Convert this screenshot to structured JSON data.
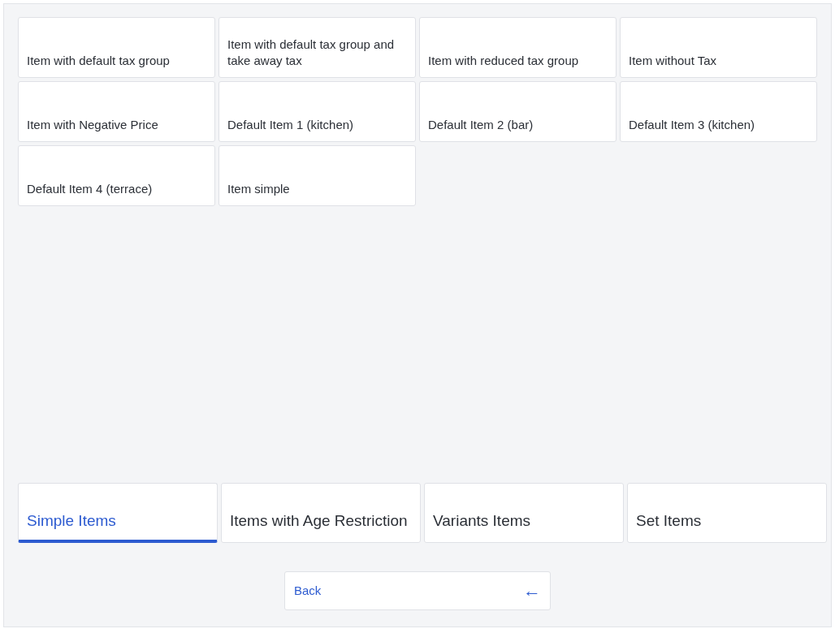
{
  "items": [
    {
      "label": "Item with default tax group"
    },
    {
      "label": "Item with default tax group and take away tax"
    },
    {
      "label": "Item with reduced tax group"
    },
    {
      "label": "Item without Tax"
    },
    {
      "label": "Item with Negative Price"
    },
    {
      "label": "Default Item 1 (kitchen)"
    },
    {
      "label": "Default Item 2 (bar)"
    },
    {
      "label": "Default Item 3 (kitchen)"
    },
    {
      "label": "Default Item 4 (terrace)"
    },
    {
      "label": "Item simple"
    }
  ],
  "tabs": [
    {
      "label": "Simple Items",
      "selected": true
    },
    {
      "label": "Items with Age Restriction",
      "selected": false
    },
    {
      "label": "Variants Items",
      "selected": false
    },
    {
      "label": "Set Items",
      "selected": false
    }
  ],
  "back_button": {
    "label": "Back",
    "icon": "←"
  }
}
